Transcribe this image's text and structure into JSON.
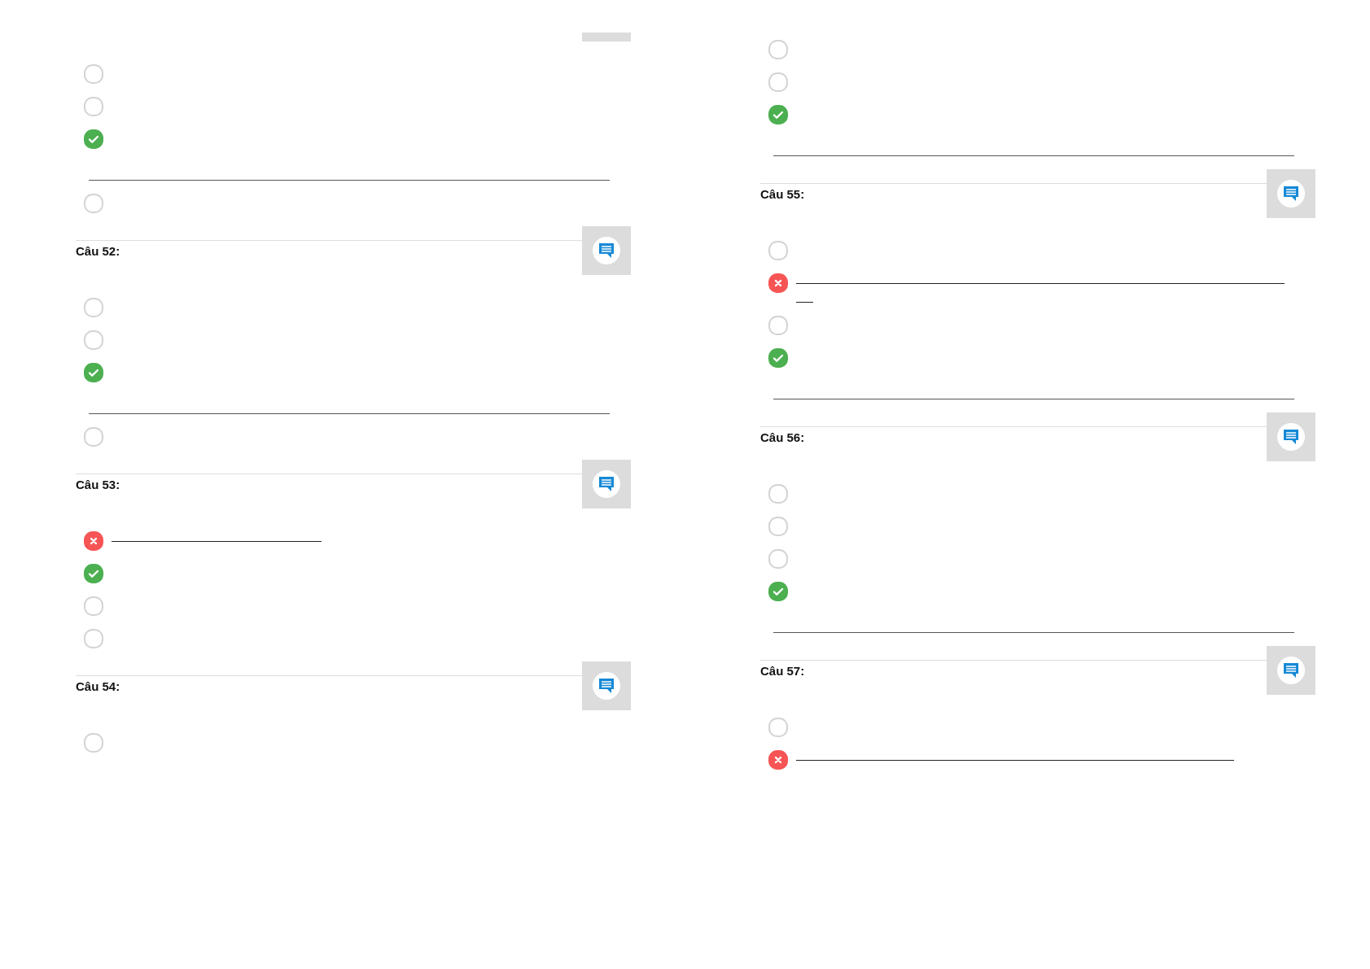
{
  "columns": [
    {
      "items": [
        {
          "kind": "stub"
        },
        {
          "kind": "option",
          "correct": false,
          "wrong": false
        },
        {
          "kind": "option",
          "correct": false,
          "wrong": false
        },
        {
          "kind": "option",
          "correct": true,
          "wrong": false
        },
        {
          "kind": "divider"
        },
        {
          "kind": "option",
          "correct": false,
          "wrong": false
        },
        {
          "kind": "question",
          "label": "Câu 52:"
        },
        {
          "kind": "option",
          "correct": false,
          "wrong": false
        },
        {
          "kind": "option",
          "correct": false,
          "wrong": false
        },
        {
          "kind": "option",
          "correct": true,
          "wrong": false
        },
        {
          "kind": "divider"
        },
        {
          "kind": "option",
          "correct": false,
          "wrong": false
        },
        {
          "kind": "question",
          "label": "Câu 53:"
        },
        {
          "kind": "option",
          "correct": false,
          "wrong": true
        },
        {
          "kind": "option",
          "correct": true,
          "wrong": false
        },
        {
          "kind": "option",
          "correct": false,
          "wrong": false
        },
        {
          "kind": "option",
          "correct": false,
          "wrong": false
        },
        {
          "kind": "question",
          "label": "Câu 54:"
        },
        {
          "kind": "option",
          "correct": false,
          "wrong": false
        }
      ]
    },
    {
      "items": [
        {
          "kind": "option",
          "correct": false,
          "wrong": false
        },
        {
          "kind": "option",
          "correct": false,
          "wrong": false
        },
        {
          "kind": "option",
          "correct": true,
          "wrong": false
        },
        {
          "kind": "divider"
        },
        {
          "kind": "question",
          "label": "Câu 55:"
        },
        {
          "kind": "option",
          "correct": false,
          "wrong": false
        },
        {
          "kind": "option",
          "correct": false,
          "wrong": true,
          "wrapped": true
        },
        {
          "kind": "option",
          "correct": false,
          "wrong": false
        },
        {
          "kind": "option",
          "correct": true,
          "wrong": false
        },
        {
          "kind": "divider"
        },
        {
          "kind": "question",
          "label": "Câu 56:"
        },
        {
          "kind": "option",
          "correct": false,
          "wrong": false
        },
        {
          "kind": "option",
          "correct": false,
          "wrong": false
        },
        {
          "kind": "option",
          "correct": false,
          "wrong": false
        },
        {
          "kind": "option",
          "correct": true,
          "wrong": false
        },
        {
          "kind": "divider"
        },
        {
          "kind": "question",
          "label": "Câu 57:"
        },
        {
          "kind": "option",
          "correct": false,
          "wrong": false
        },
        {
          "kind": "option",
          "correct": false,
          "wrong": true
        }
      ]
    }
  ]
}
